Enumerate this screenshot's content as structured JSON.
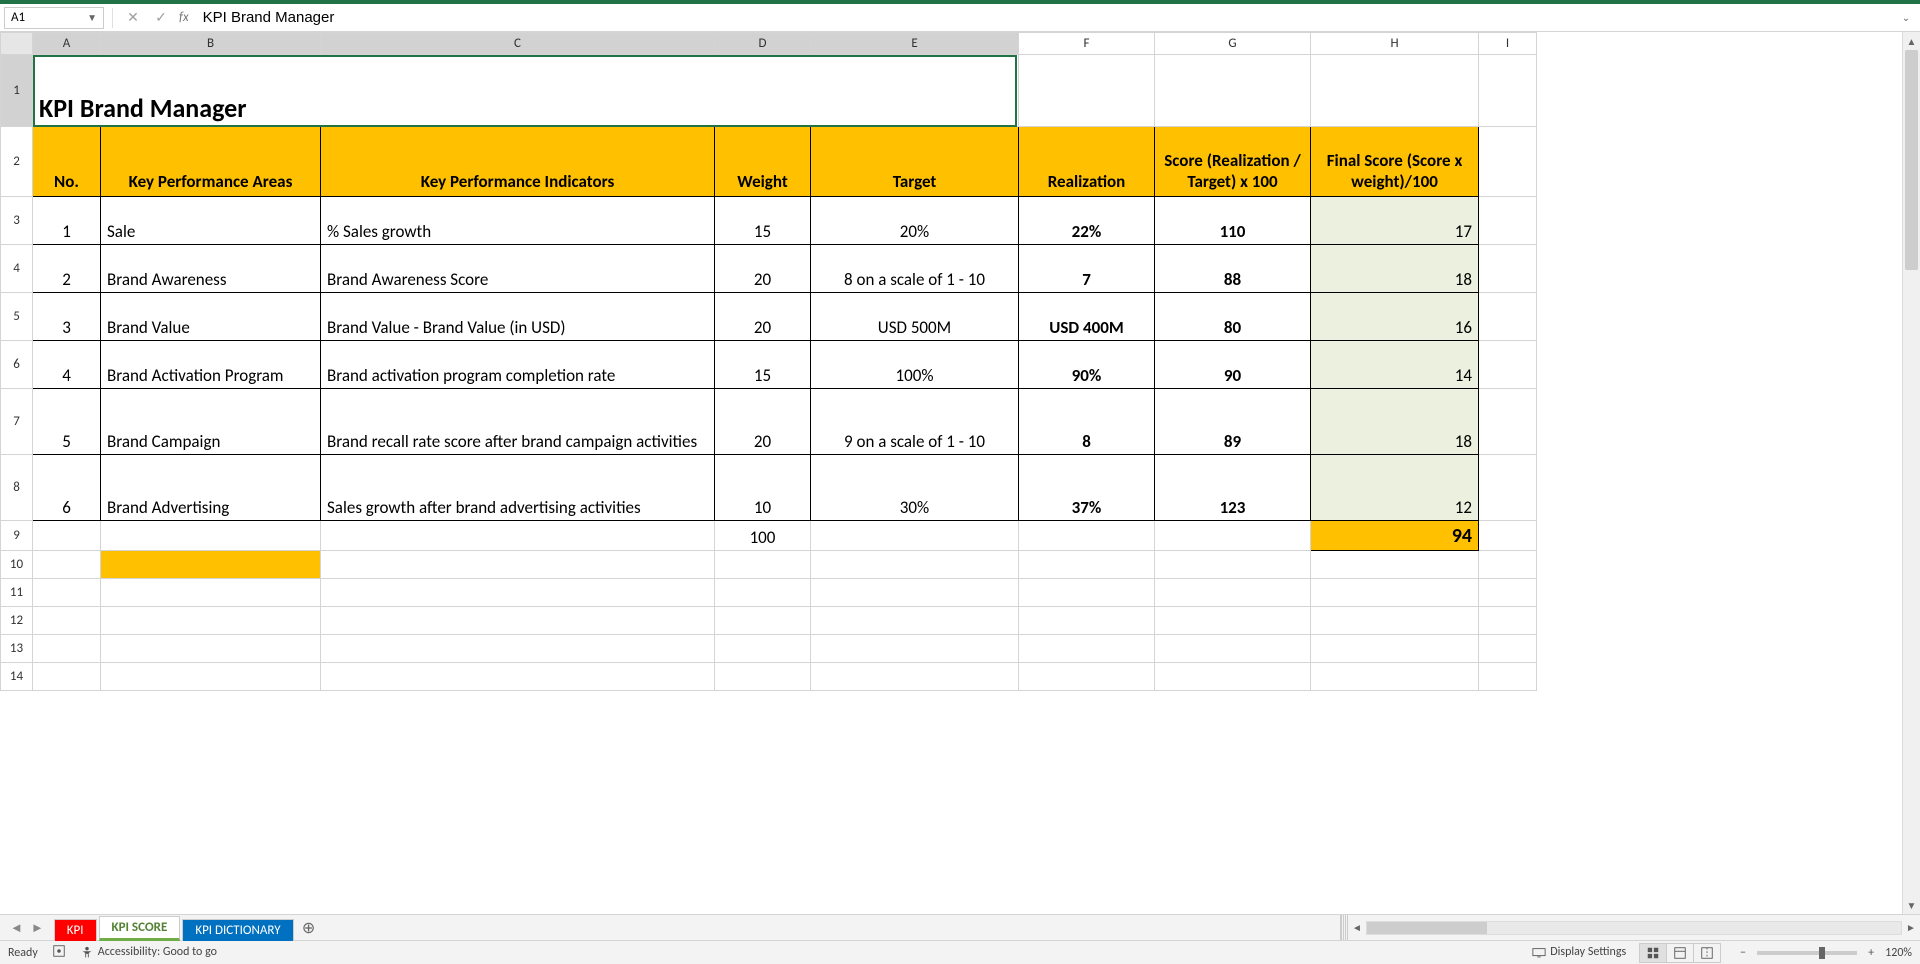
{
  "formula_bar": {
    "name_box": "A1",
    "fx_label": "fx",
    "formula_value": "KPI Brand Manager"
  },
  "columns": [
    "A",
    "B",
    "C",
    "D",
    "E",
    "F",
    "G",
    "H",
    "I"
  ],
  "row_numbers": [
    1,
    2,
    3,
    4,
    5,
    6,
    7,
    8,
    9,
    10,
    11,
    12,
    13,
    14
  ],
  "title": "KPI Brand Manager",
  "headers": {
    "no": "No.",
    "kpa": "Key Performance Areas",
    "kpi": "Key Performance Indicators",
    "weight": "Weight",
    "target": "Target",
    "realization": "Realization",
    "score": "Score (Realization / Target) x 100",
    "final": "Final Score (Score x weight)/100"
  },
  "rows": [
    {
      "no": "1",
      "kpa": "Sale",
      "kpi": "% Sales growth",
      "weight": "15",
      "target": "20%",
      "realization": "22%",
      "score": "110",
      "final": "17",
      "tall": false
    },
    {
      "no": "2",
      "kpa": "Brand Awareness",
      "kpi": "Brand Awareness Score",
      "weight": "20",
      "target": "8 on a scale of 1 - 10",
      "realization": "7",
      "score": "88",
      "final": "18",
      "tall": false
    },
    {
      "no": "3",
      "kpa": "Brand Value",
      "kpi": "Brand Value - Brand Value (in USD)",
      "weight": "20",
      "target": "USD 500M",
      "realization": "USD 400M",
      "score": "80",
      "final": "16",
      "tall": false
    },
    {
      "no": "4",
      "kpa": "Brand Activation Program",
      "kpi": "Brand activation program completion rate",
      "weight": "15",
      "target": "100%",
      "realization": "90%",
      "score": "90",
      "final": "14",
      "tall": false
    },
    {
      "no": "5",
      "kpa": "Brand Campaign",
      "kpi": "Brand recall rate score after brand campaign activities",
      "weight": "20",
      "target": "9 on a scale of 1 - 10",
      "realization": "8",
      "score": "89",
      "final": "18",
      "tall": true
    },
    {
      "no": "6",
      "kpa": "Brand Advertising",
      "kpi": "Sales growth after brand advertising activities",
      "weight": "10",
      "target": "30%",
      "realization": "37%",
      "score": "123",
      "final": "12",
      "tall": true
    }
  ],
  "totals": {
    "weight": "100",
    "final": "94"
  },
  "sheet_tabs": {
    "tab1": "KPI",
    "tab2": "KPI SCORE",
    "tab3": "KPI DICTIONARY"
  },
  "status": {
    "ready": "Ready",
    "accessibility": "Accessibility: Good to go",
    "display_settings": "Display Settings",
    "zoom": "120%"
  }
}
